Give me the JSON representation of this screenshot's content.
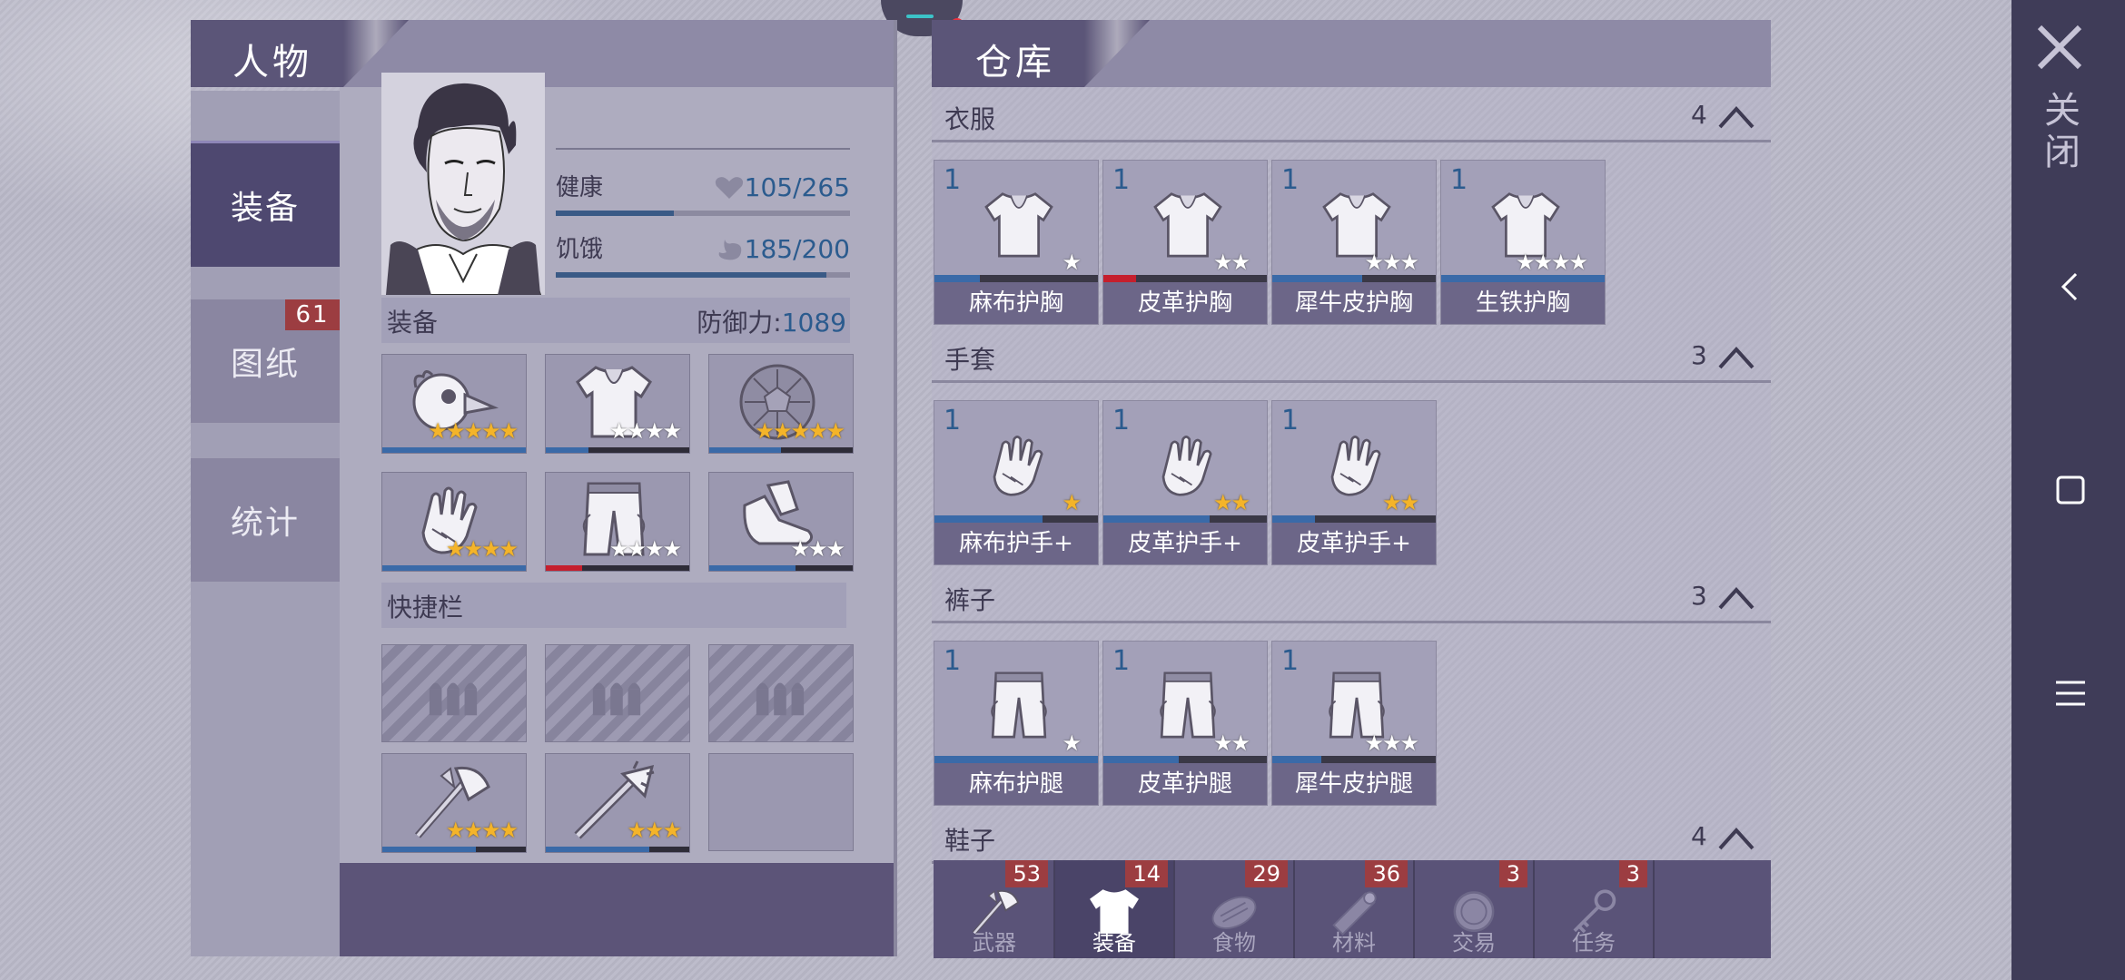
{
  "character_panel": {
    "title": "人物",
    "tabs": [
      {
        "label": "装备",
        "active": true
      },
      {
        "label": "图纸",
        "badge": "61"
      },
      {
        "label": "统计"
      }
    ],
    "stats": [
      {
        "label": "健康",
        "value": "105/265",
        "fill": 0.4,
        "icon": "heart-icon"
      },
      {
        "label": "饥饿",
        "value": "185/200",
        "fill": 0.92,
        "icon": "stomach-icon"
      }
    ],
    "equipment": {
      "label": "装备",
      "defense_label": "防御力:",
      "defense_value": "1089",
      "slots": [
        {
          "icon": "bird-mask-helmet-icon",
          "stars": 5,
          "star_color": "gold",
          "durability": 1.0,
          "bar_color": "#3a6aa8"
        },
        {
          "icon": "vest-icon",
          "stars": 4,
          "star_color": "white",
          "durability": 0.3,
          "bar_color": "#3a6aa8"
        },
        {
          "icon": "turtle-shell-icon",
          "stars": 5,
          "star_color": "gold",
          "durability": 0.5,
          "bar_color": "#3a6aa8"
        },
        {
          "icon": "gloves-icon",
          "stars": 4,
          "star_color": "gold",
          "durability": 1.0,
          "bar_color": "#3a6aa8"
        },
        {
          "icon": "pants-icon",
          "stars": 4,
          "star_color": "white",
          "durability": 0.25,
          "bar_color": "#c51f2d"
        },
        {
          "icon": "boots-icon",
          "stars": 3,
          "star_color": "white",
          "durability": 0.6,
          "bar_color": "#3a6aa8"
        }
      ]
    },
    "quickbar": {
      "label": "快捷栏",
      "slots": [
        {
          "type": "empty"
        },
        {
          "type": "empty"
        },
        {
          "type": "empty"
        },
        {
          "icon": "axe-icon",
          "stars": 4,
          "star_color": "gold",
          "durability": 0.65
        },
        {
          "icon": "spiked-club-icon",
          "stars": 3,
          "star_color": "gold",
          "durability": 0.72
        },
        {
          "type": "blank"
        }
      ]
    }
  },
  "warehouse_panel": {
    "title": "仓库",
    "sections": [
      {
        "title": "衣服",
        "count": "4",
        "items": [
          {
            "count": "1",
            "name": "麻布护胸",
            "icon": "cloth-vest-icon",
            "stars": 1,
            "star_color": "white",
            "durability": 0.28,
            "bar_color": "#3a6aa8"
          },
          {
            "count": "1",
            "name": "皮革护胸",
            "icon": "leather-vest-icon",
            "stars": 2,
            "star_color": "white",
            "durability": 0.2,
            "bar_color": "#c51f2d"
          },
          {
            "count": "1",
            "name": "犀牛皮护胸",
            "icon": "rhino-vest-icon",
            "stars": 3,
            "star_color": "white",
            "durability": 0.55,
            "bar_color": "#3a6aa8"
          },
          {
            "count": "1",
            "name": "生铁护胸",
            "icon": "iron-vest-icon",
            "stars": 4,
            "star_color": "white",
            "durability": 1.0,
            "bar_color": "#3a6aa8"
          }
        ]
      },
      {
        "title": "手套",
        "count": "3",
        "items": [
          {
            "count": "1",
            "name": "麻布护手+",
            "icon": "cloth-gloves-icon",
            "stars": 1,
            "star_color": "gold",
            "durability": 0.66,
            "bar_color": "#3a6aa8"
          },
          {
            "count": "1",
            "name": "皮革护手+",
            "icon": "leather-gloves-icon",
            "stars": 2,
            "star_color": "gold",
            "durability": 0.65,
            "bar_color": "#3a6aa8"
          },
          {
            "count": "1",
            "name": "皮革护手+",
            "icon": "leather-gloves-icon",
            "stars": 2,
            "star_color": "gold",
            "durability": 0.26,
            "bar_color": "#3a6aa8"
          }
        ]
      },
      {
        "title": "裤子",
        "count": "3",
        "items": [
          {
            "count": "1",
            "name": "麻布护腿",
            "icon": "cloth-pants-icon",
            "stars": 1,
            "star_color": "white",
            "durability": 1.0,
            "bar_color": "#3a6aa8"
          },
          {
            "count": "1",
            "name": "皮革护腿",
            "icon": "leather-pants-icon",
            "stars": 2,
            "star_color": "white",
            "durability": 0.46,
            "bar_color": "#3a6aa8"
          },
          {
            "count": "1",
            "name": "犀牛皮护腿",
            "icon": "rhino-pants-icon",
            "stars": 3,
            "star_color": "white",
            "durability": 0.3,
            "bar_color": "#3a6aa8"
          }
        ]
      },
      {
        "title": "鞋子",
        "count": "4",
        "items": []
      }
    ],
    "bottom_tabs": [
      {
        "label": "武器",
        "badge": "53",
        "icon": "axe-icon"
      },
      {
        "label": "装备",
        "badge": "14",
        "icon": "shirt-icon",
        "active": true
      },
      {
        "label": "食物",
        "badge": "29",
        "icon": "meat-icon"
      },
      {
        "label": "材料",
        "badge": "36",
        "icon": "log-icon"
      },
      {
        "label": "交易",
        "badge": "3",
        "icon": "coin-icon"
      },
      {
        "label": "任务",
        "badge": "3",
        "icon": "key-icon"
      }
    ]
  },
  "navbar": {
    "close_label": "关闭",
    "buttons": [
      "back-icon",
      "square-icon",
      "menu-icon"
    ]
  }
}
